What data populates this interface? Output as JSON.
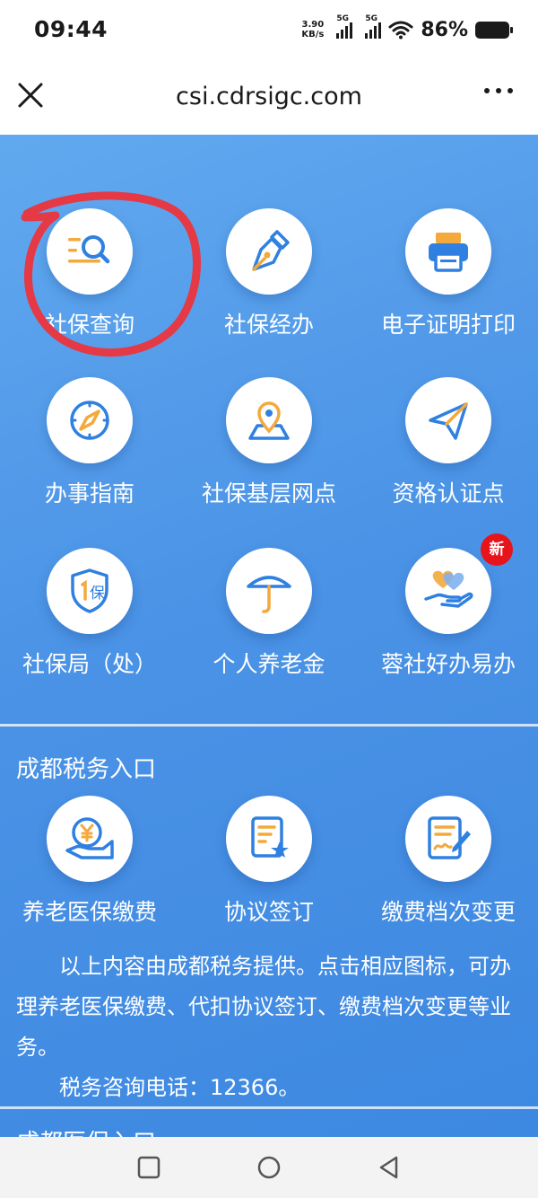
{
  "status_bar": {
    "time": "09:44",
    "net_speed_value": "3.90",
    "net_speed_unit": "KB/s",
    "signal_1_tag": "5G",
    "signal_2_tag": "5G",
    "battery_percent": "86%"
  },
  "browser": {
    "url": "csi.cdrsigc.com"
  },
  "services": [
    {
      "label": "社保查询",
      "icon": "search-list-icon"
    },
    {
      "label": "社保经办",
      "icon": "pen-nib-icon"
    },
    {
      "label": "电子证明打印",
      "icon": "printer-icon"
    },
    {
      "label": "办事指南",
      "icon": "compass-icon"
    },
    {
      "label": "社保基层网点",
      "icon": "location-pin-icon"
    },
    {
      "label": "资格认证点",
      "icon": "paper-plane-icon"
    },
    {
      "label": "社保局（处）",
      "icon": "shield-bao-icon"
    },
    {
      "label": "个人养老金",
      "icon": "umbrella-icon"
    },
    {
      "label": "蓉社好办易办",
      "icon": "hand-hearts-icon",
      "badge": "新"
    }
  ],
  "tax_section": {
    "title": "成都税务入口",
    "items": [
      {
        "label": "养老医保缴费",
        "icon": "yuan-hand-icon"
      },
      {
        "label": "协议签订",
        "icon": "document-star-icon"
      },
      {
        "label": "缴费档次变更",
        "icon": "document-signature-icon"
      }
    ],
    "description_1": "以上内容由成都税务提供。点击相应图标，可办理养老医保缴费、代扣协议签订、缴费档次变更等业务。",
    "description_2": "税务咨询电话：12366。"
  },
  "next_section_title": "成都医保入口",
  "colors": {
    "background_blue": "#4b93e6",
    "icon_blue": "#2f80e0",
    "icon_orange": "#f3a93c",
    "badge_red": "#e8141c",
    "annotation_red": "#e53945"
  }
}
